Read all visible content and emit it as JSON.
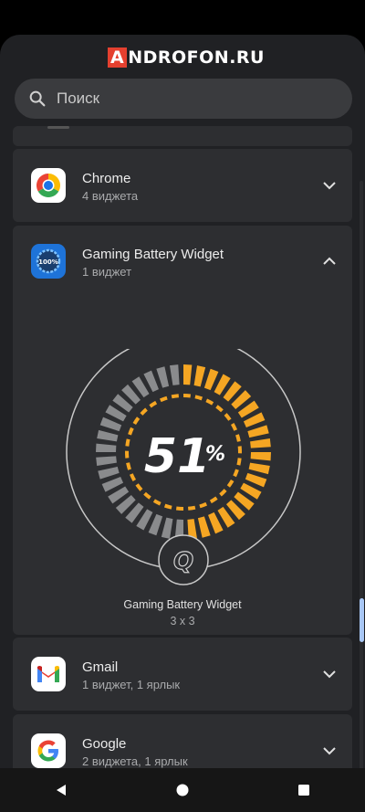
{
  "watermark": {
    "first": "A",
    "rest": "NDROFON.RU"
  },
  "search": {
    "placeholder": "Поиск"
  },
  "apps": [
    {
      "name": "Chrome",
      "sub": "4 виджета"
    },
    {
      "name": "Gaming Battery Widget",
      "sub": "1 виджет"
    },
    {
      "name": "Gmail",
      "sub": "1 виджет, 1 ярлык"
    },
    {
      "name": "Google",
      "sub": "2 виджета, 1 ярлык"
    }
  ],
  "widget_preview": {
    "percent_number": "51",
    "percent_sign": "%",
    "logo_glyph": "Q",
    "label": "Gaming Battery Widget",
    "size": "3 x 3",
    "level": 51
  },
  "icon_battery_text": "100%",
  "colors": {
    "accent_orange": "#f5a623",
    "segment_gray": "#8a8b8d",
    "sheet": "#202124",
    "card": "#2d2e31"
  }
}
